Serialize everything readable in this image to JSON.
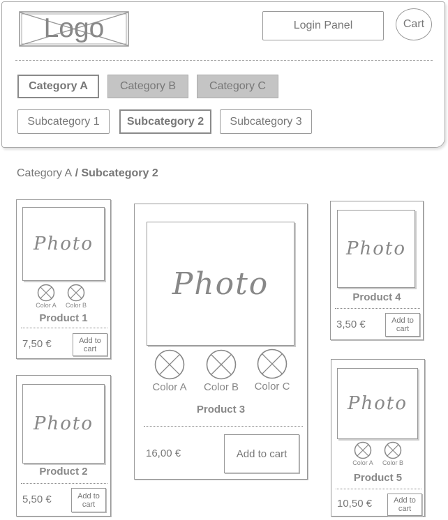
{
  "header": {
    "logo_text": "Logo",
    "login_label": "Login Panel",
    "cart_label": "Cart",
    "categories": [
      {
        "label": "Category A",
        "state": "active"
      },
      {
        "label": "Category B",
        "state": "inactive"
      },
      {
        "label": "Category C",
        "state": "inactive"
      }
    ],
    "subcategories": [
      {
        "label": "Subcategory 1",
        "state": "normal"
      },
      {
        "label": "Subcategory 2",
        "state": "active"
      },
      {
        "label": "Subcategory 3",
        "state": "normal"
      }
    ]
  },
  "breadcrumb": {
    "category": "Category A",
    "separator": " / ",
    "subcategory": "Subcategory 2"
  },
  "products": [
    {
      "name": "Product 1",
      "photo_label": "Photo",
      "price": "7,50 €",
      "add_label": "Add to cart",
      "colors": [
        "Color A",
        "Color B"
      ]
    },
    {
      "name": "Product 2",
      "photo_label": "Photo",
      "price": "5,50 €",
      "add_label": "Add to cart",
      "colors": []
    },
    {
      "name": "Product 3",
      "photo_label": "Photo",
      "price": "16,00 €",
      "add_label": "Add to cart",
      "colors": [
        "Color A",
        "Color B",
        "Color C"
      ]
    },
    {
      "name": "Product 4",
      "photo_label": "Photo",
      "price": "3,50 €",
      "add_label": "Add to cart",
      "colors": []
    },
    {
      "name": "Product 5",
      "photo_label": "Photo",
      "price": "10,50 €",
      "add_label": "Add to cart",
      "colors": [
        "Color A",
        "Color B"
      ]
    }
  ],
  "icons": {
    "logo_placeholder": "image-placeholder-icon",
    "color_swatch": "swatch-x-icon"
  },
  "colors": {
    "line": "#999999",
    "inactive_fill": "#c4c4c4",
    "text": "#777777"
  }
}
